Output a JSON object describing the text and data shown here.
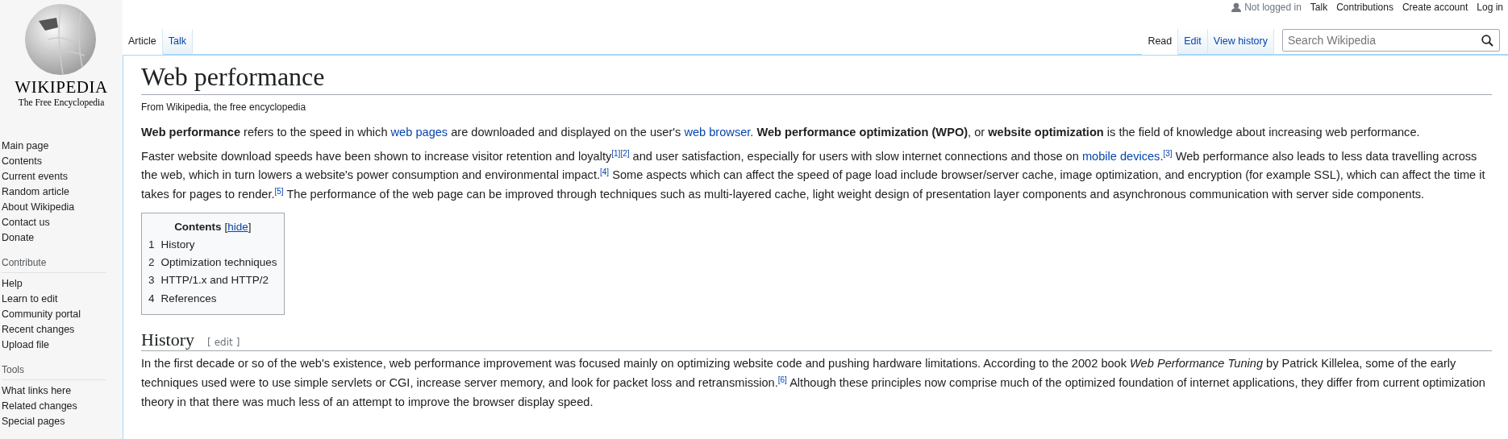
{
  "logo": {
    "wordmark": "WIKIPEDIA",
    "tagline": "The Free Encyclopedia"
  },
  "sidebar": {
    "navigation": [
      "Main page",
      "Contents",
      "Current events",
      "Random article",
      "About Wikipedia",
      "Contact us",
      "Donate"
    ],
    "sections": [
      {
        "heading": "Contribute",
        "items": [
          "Help",
          "Learn to edit",
          "Community portal",
          "Recent changes",
          "Upload file"
        ]
      },
      {
        "heading": "Tools",
        "items": [
          "What links here",
          "Related changes",
          "Special pages"
        ]
      }
    ]
  },
  "personal_tools": {
    "status": "Not logged in",
    "links": [
      "Talk",
      "Contributions",
      "Create account",
      "Log in"
    ]
  },
  "namespace_tabs": [
    {
      "label": "Article",
      "selected": true
    },
    {
      "label": "Talk",
      "selected": false
    }
  ],
  "view_tabs": [
    {
      "label": "Read",
      "selected": true
    },
    {
      "label": "Edit",
      "selected": false
    },
    {
      "label": "View history",
      "selected": false
    }
  ],
  "search": {
    "placeholder": "Search Wikipedia"
  },
  "article": {
    "title": "Web performance",
    "subtitle": "From Wikipedia, the free encyclopedia",
    "lead": [
      [
        {
          "kind": "text",
          "text": "**Web performance** refers to the speed in which "
        },
        {
          "kind": "link",
          "text": "web pages"
        },
        {
          "kind": "text",
          "text": " are downloaded and displayed on the user's "
        },
        {
          "kind": "link",
          "text": "web browser"
        },
        {
          "kind": "text",
          "text": ". **Web performance optimization (WPO)**, or **website optimization** is the field of knowledge about increasing web performance."
        }
      ],
      [
        {
          "kind": "text",
          "text": "Faster website download speeds have been shown to increase visitor retention and loyalty"
        },
        {
          "kind": "ref",
          "text": "[1]"
        },
        {
          "kind": "ref",
          "text": "[2]"
        },
        {
          "kind": "text",
          "text": " and user satisfaction, especially for users with slow internet connections and those on "
        },
        {
          "kind": "link",
          "text": "mobile devices"
        },
        {
          "kind": "text",
          "text": "."
        },
        {
          "kind": "ref",
          "text": "[3]"
        },
        {
          "kind": "text",
          "text": " Web performance also leads to less data travelling across the web, which in turn lowers a website's power consumption and environmental impact."
        },
        {
          "kind": "ref",
          "text": "[4]"
        },
        {
          "kind": "text",
          "text": " Some aspects which can affect the speed of page load include browser/server cache, image optimization, and encryption (for example SSL), which can affect the time it takes for pages to render."
        },
        {
          "kind": "ref",
          "text": "[5]"
        },
        {
          "kind": "text",
          "text": " The performance of the web page can be improved through techniques such as multi-layered cache, light weight design of presentation layer components and asynchronous communication with server side components."
        }
      ]
    ],
    "toc": {
      "title": "Contents",
      "toggle_open": "[",
      "toggle": "hide",
      "toggle_close": "]",
      "entries": [
        {
          "number": "1",
          "label": "History"
        },
        {
          "number": "2",
          "label": "Optimization techniques"
        },
        {
          "number": "3",
          "label": "HTTP/1.x and HTTP/2"
        },
        {
          "number": "4",
          "label": "References"
        }
      ]
    },
    "sections": [
      {
        "heading": "History",
        "edit_open": "[",
        "edit": "edit",
        "edit_close": "]",
        "paragraphs": [
          [
            {
              "kind": "text",
              "text": "In the first decade or so of the web's existence, web performance improvement was focused mainly on optimizing website code and pushing hardware limitations. According to the 2002 book *Web Performance Tuning* by Patrick Killelea, some of the early techniques used were to use simple servlets or CGI, increase server memory, and look for packet loss and retransmission."
            },
            {
              "kind": "ref",
              "text": "[6]"
            },
            {
              "kind": "text",
              "text": " Although these principles now comprise much of the optimized foundation of internet applications, they differ from current optimization theory in that there was much less of an attempt to improve the browser display speed."
            }
          ]
        ]
      }
    ]
  }
}
